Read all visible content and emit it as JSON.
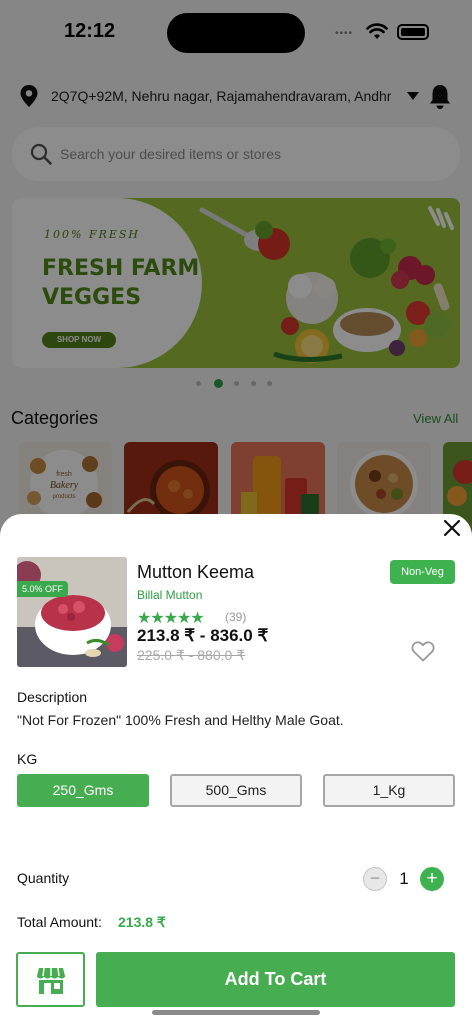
{
  "status_bar": {
    "time": "12:12",
    "signal_dots": "••••"
  },
  "location": {
    "address": "2Q7Q+92M, Nehru nagar, Rajamahendravaram, Andhra ..."
  },
  "search": {
    "placeholder": "Search your desired items or stores"
  },
  "banner": {
    "tag": "100% FRESH",
    "title": "FRESH FARM VEGGES",
    "button": "SHOP NOW"
  },
  "carousel": {
    "count": 5,
    "active_index": 1
  },
  "categories": {
    "title": "Categories",
    "view_all": "View All",
    "bakery_tile_text": "fresh Bakery products"
  },
  "product": {
    "name": "Mutton Keema",
    "store": "Billal Mutton",
    "veg_label": "Non-Veg",
    "discount": "5.0% OFF",
    "stars": "★★★★★",
    "rating_count": "(39)",
    "rating": 5,
    "price_range": "213.8 ₹ - 836.0 ₹",
    "mrp_range": "225.0 ₹ - 880.0 ₹"
  },
  "description": {
    "label": "Description",
    "text": "\"Not For Frozen\" 100% Fresh and Helthy Male Goat."
  },
  "unit": {
    "label": "KG",
    "options": [
      "250_Gms",
      "500_Gms",
      "1_Kg"
    ],
    "selected": "250_Gms"
  },
  "quantity": {
    "label": "Quantity",
    "value": "1",
    "minus": "−",
    "plus": "+"
  },
  "total": {
    "label": "Total Amount:",
    "value": "213.8 ₹"
  },
  "actions": {
    "add_to_cart": "Add To Cart"
  },
  "colors": {
    "accent": "#46ad50",
    "accent_dark": "#2e9e43",
    "overlay": "rgba(0,0,0,0.45)"
  }
}
